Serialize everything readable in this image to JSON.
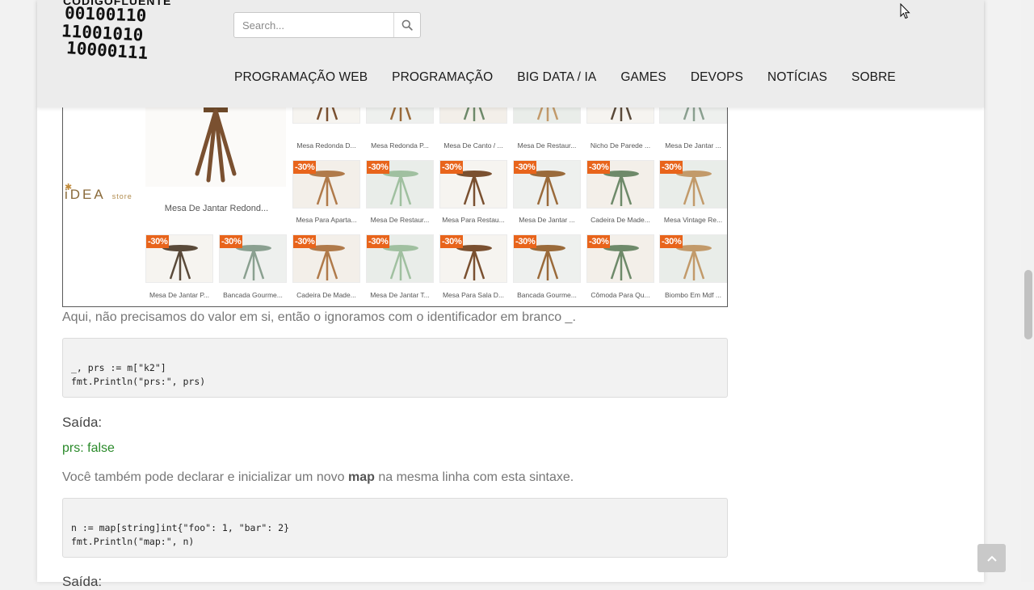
{
  "header": {
    "logo_text": "CODIGOFLUENTE",
    "logo_binary": [
      "00100110",
      "11001010",
      "10000111"
    ],
    "search_placeholder": "Search...",
    "nav": [
      "PROGRAMAÇÃO WEB",
      "PROGRAMAÇÃO",
      "BIG DATA / IA",
      "GAMES",
      "DEVOPS",
      "NOTÍCIAS",
      "SOBRE"
    ]
  },
  "ad": {
    "brand": "iDEA",
    "brand_suffix": "store",
    "badge": "-30%",
    "featured_label": "Mesa De Jantar Redond...",
    "row1_captions": [
      "Mesa Redonda D...",
      "Mesa Redonda P...",
      "Mesa De Canto / ...",
      "Mesa De Restaur...",
      "Nicho De Parede ...",
      "Mesa De Jantar ..."
    ],
    "row2_captions": [
      "Mesa Para Aparta...",
      "Mesa De Restaur...",
      "Mesa Para Restau...",
      "Mesa De Jantar ...",
      "Cadeira De Made...",
      "Mesa Vintage Re..."
    ],
    "row3_captions": [
      "Mesa De Jantar P...",
      "Bancada Gourme...",
      "Cadeira De Made...",
      "Mesa De Jantar T...",
      "Mesa Para Sala D...",
      "Bancada Gourme...",
      "Cômoda Para Qu...",
      "Biombo Em Mdf ..."
    ]
  },
  "content": {
    "para1": "Aqui, não precisamos do valor em si, então o ignoramos com o identificador em branco _.",
    "code1": "_, prs := m[\"k2\"]\nfmt.Println(\"prs:\", prs)",
    "saida1": "Saída:",
    "output1": "prs: false",
    "para2_before": "Você também pode declarar e inicializar um novo ",
    "para2_bold": "map",
    "para2_after": " na mesma linha com esta sintaxe.",
    "code2": "n := map[string]int{\"foo\": 1, \"bar\": 2}\nfmt.Println(\"map:\", n)",
    "saida2": "Saída:"
  },
  "colors": {
    "accent_badge": "#e8641b",
    "output_green": "#2a8a2a",
    "header_bg": "#ececec"
  }
}
